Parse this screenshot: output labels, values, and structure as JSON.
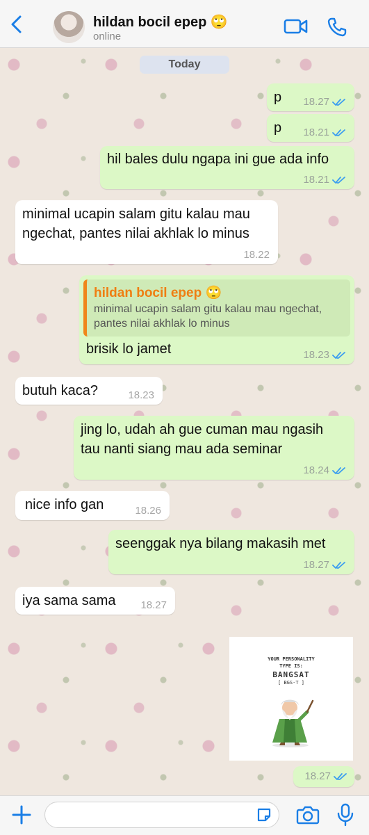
{
  "header": {
    "contact_name": "hildan bocil epep 🙄",
    "status": "online",
    "accent": "#1a7ee6"
  },
  "date_divider": "Today",
  "messages": [
    {
      "dir": "out",
      "text": "p",
      "time": "18.27",
      "read": true
    },
    {
      "dir": "out",
      "text": "p",
      "time": "18.21",
      "read": true
    },
    {
      "dir": "out",
      "text": "hil bales dulu ngapa ini gue ada info",
      "time": "18.21",
      "read": true
    },
    {
      "dir": "in",
      "lines": [
        "minimal ucapin salam gitu kalau mau",
        "ngechat, pantes nilai akhlak lo minus"
      ],
      "time": "18.22"
    },
    {
      "dir": "out",
      "quote": {
        "name": "hildan bocil epep 🙄",
        "lines": [
          "minimal ucapin salam gitu kalau mau ngechat,",
          "pantes nilai akhlak lo minus"
        ]
      },
      "text": "brisik lo jamet",
      "time": "18.23",
      "read": true
    },
    {
      "dir": "in",
      "text": "butuh kaca?",
      "time": "18.23"
    },
    {
      "dir": "out",
      "lines": [
        "jing lo, udah ah gue cuman mau ngasih",
        "tau nanti siang mau ada seminar"
      ],
      "time": "18.24",
      "read": true
    },
    {
      "dir": "in",
      "text": "nice info gan",
      "time": "18.26"
    },
    {
      "dir": "out",
      "text": "seenggak nya bilang makasih met",
      "time": "18.27",
      "read": true
    },
    {
      "dir": "in",
      "text": "iya sama sama",
      "time": "18.27"
    },
    {
      "dir": "out",
      "type": "sticker",
      "sticker": {
        "line1": "YOUR PERSONALITY",
        "line2": "TYPE IS:",
        "title": "BANGSAT",
        "code": "[ BGS-T ]"
      },
      "time": "18.27",
      "read": true
    }
  ],
  "input": {
    "placeholder": ""
  },
  "icons": [
    "back-chevron-icon",
    "video-call-icon",
    "phone-icon",
    "plus-icon",
    "sticker-icon",
    "camera-icon",
    "microphone-icon",
    "double-check-icon"
  ]
}
